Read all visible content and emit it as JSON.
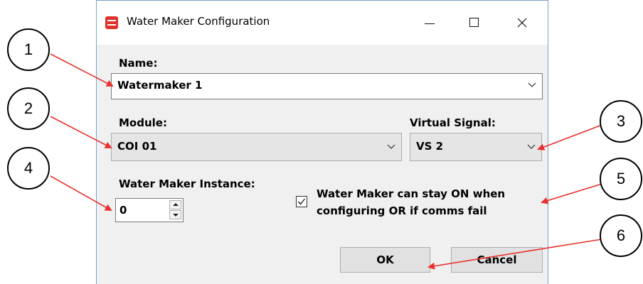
{
  "window": {
    "title": "Water Maker Configuration"
  },
  "form": {
    "name_label": "Name:",
    "name_value": "Watermaker 1",
    "module_label": "Module:",
    "module_value": "COI 01",
    "virtual_signal_label": "Virtual Signal:",
    "virtual_signal_value": "VS 2",
    "instance_label": "Water Maker Instance:",
    "instance_value": "0",
    "stay_on_line1": "Water Maker can stay ON when",
    "stay_on_line2": "configuring OR if comms fail",
    "stay_on_checked": true
  },
  "buttons": {
    "ok": "OK",
    "cancel": "Cancel"
  },
  "callouts": [
    "1",
    "2",
    "3",
    "4",
    "5",
    "6"
  ],
  "colors": {
    "arrow": "#e8302c",
    "app_icon": "#e0302c"
  }
}
